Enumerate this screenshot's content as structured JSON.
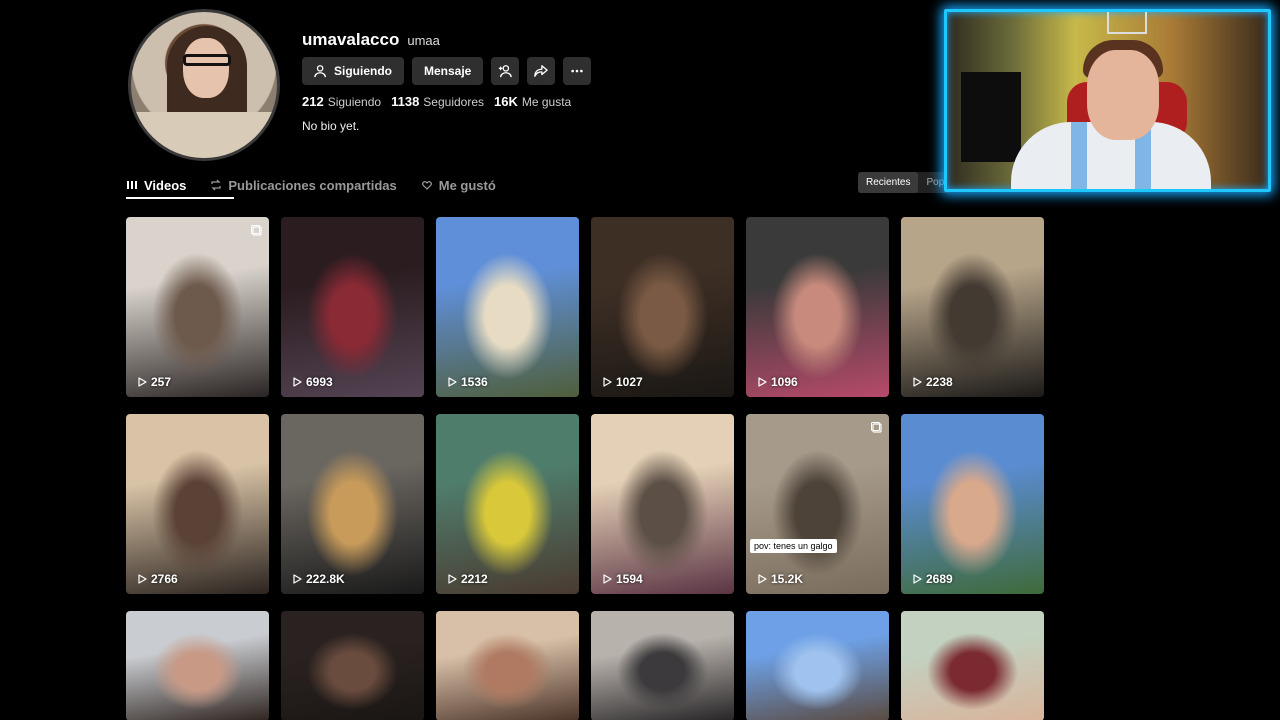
{
  "profile": {
    "username": "umavalacco",
    "nickname": "umaa",
    "bio": "No bio yet."
  },
  "actions": {
    "following_label": "Siguiendo",
    "message_label": "Mensaje"
  },
  "stats": {
    "following_count": "212",
    "following_label": "Siguiendo",
    "followers_count": "1138",
    "followers_label": "Seguidores",
    "likes_count": "16K",
    "likes_label": "Me gusta"
  },
  "tabs": [
    {
      "label": "Videos",
      "icon": "grid-icon",
      "active": true
    },
    {
      "label": "Publicaciones compartidas",
      "icon": "repost-icon",
      "active": false
    },
    {
      "label": "Me gustó",
      "icon": "heart-icon",
      "active": false
    }
  ],
  "sort": {
    "recent_label": "Recientes",
    "popular_label": "Pop"
  },
  "videos": [
    {
      "views": "257",
      "colors": [
        "#d9d3cc",
        "#6e5a4c",
        "#2a2424"
      ],
      "multi": true
    },
    {
      "views": "6993",
      "colors": [
        "#2a1c1f",
        "#8a2a35",
        "#544454"
      ]
    },
    {
      "views": "1536",
      "colors": [
        "#5f8fd8",
        "#e7dcc3",
        "#4f5e3a"
      ]
    },
    {
      "views": "1027",
      "colors": [
        "#3e2f25",
        "#7a5a44",
        "#1a1714"
      ]
    },
    {
      "views": "1096",
      "colors": [
        "#3a3a3a",
        "#c78a7c",
        "#b74a6a"
      ]
    },
    {
      "views": "2238",
      "colors": [
        "#b7a58a",
        "#433a32",
        "#1c1a18"
      ]
    },
    {
      "views": "2766",
      "colors": [
        "#d8c3a6",
        "#5a4236",
        "#2c2420"
      ]
    },
    {
      "views": "222.8K",
      "colors": [
        "#6a6660",
        "#c89b5a",
        "#1a1a1a"
      ]
    },
    {
      "views": "2212",
      "colors": [
        "#4f7d6c",
        "#d8c83a",
        "#4a3a30"
      ]
    },
    {
      "views": "1594",
      "colors": [
        "#e4d0b6",
        "#5c5046",
        "#5a3444"
      ]
    },
    {
      "views": "15.2K",
      "colors": [
        "#a69a8a",
        "#4d4339",
        "#7a6c5c"
      ],
      "multi": true,
      "caption": "pov: tenes un galgo"
    },
    {
      "views": "2689",
      "colors": [
        "#5a8cd2",
        "#d9a98c",
        "#3f6a3a"
      ]
    },
    {
      "views": "",
      "colors": [
        "#c9ccd0",
        "#c89a86",
        "#2e2420"
      ]
    },
    {
      "views": "",
      "colors": [
        "#2a2220",
        "#6a4c3e",
        "#1a1614"
      ]
    },
    {
      "views": "",
      "colors": [
        "#d8c0a8",
        "#b07a62",
        "#4a3428"
      ]
    },
    {
      "views": "",
      "colors": [
        "#b8b2ac",
        "#3c3a3c",
        "#262426"
      ]
    },
    {
      "views": "",
      "colors": [
        "#6da0e6",
        "#9fc3ee",
        "#5a4a40"
      ]
    },
    {
      "views": "",
      "colors": [
        "#c3d1c0",
        "#7a2a30",
        "#d9b49c"
      ]
    }
  ]
}
